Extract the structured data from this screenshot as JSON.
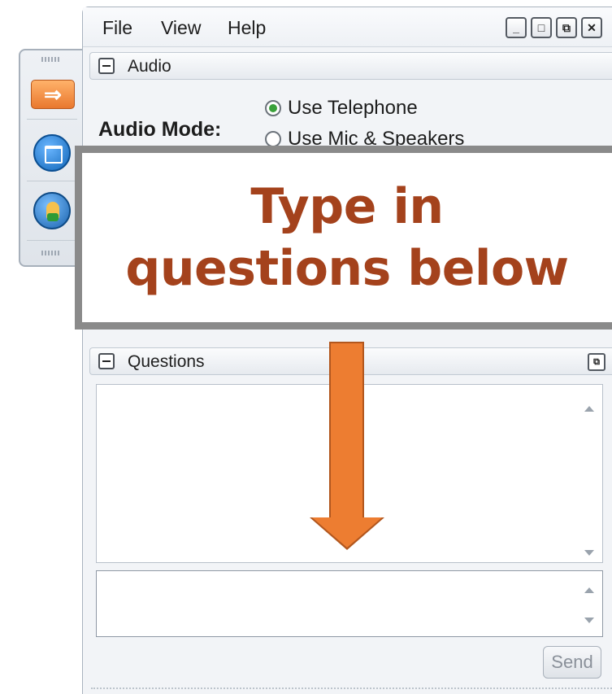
{
  "menu": {
    "file": "File",
    "view": "View",
    "help": "Help"
  },
  "window_buttons": {
    "minimize": "_",
    "maximize": "□",
    "restore": "⧉",
    "close": "✕"
  },
  "audio_panel": {
    "title": "Audio",
    "mode_label": "Audio Mode:",
    "options": [
      "Use Telephone",
      "Use Mic & Speakers"
    ],
    "selected": "Use Telephone"
  },
  "questions_panel": {
    "title": "Questions",
    "send_label": "Send"
  },
  "callout": {
    "line1": "Type in",
    "line2": "questions below"
  },
  "colors": {
    "callout_text": "#a4421c",
    "arrow": "#ed7d31",
    "callout_border": "#8a8a8a"
  },
  "toolbar_icons": [
    "hand-arrow-icon",
    "window-icon",
    "raise-hand-icon"
  ]
}
